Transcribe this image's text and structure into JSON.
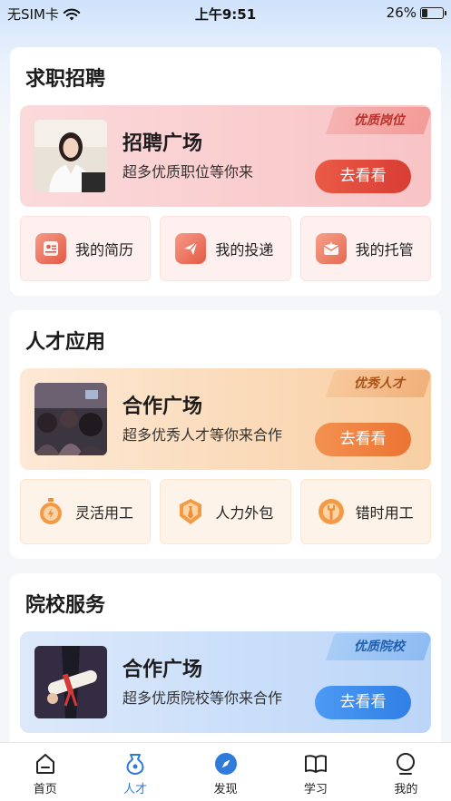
{
  "status": {
    "carrier": "无SIM卡",
    "time": "上午9:51",
    "battery": "26%",
    "battery_level": 0.26
  },
  "sections": [
    {
      "title": "求职招聘",
      "banner": {
        "tag": "优质岗位",
        "title": "招聘广场",
        "subtitle": "超多优质职位等你来",
        "button": "去看看"
      },
      "tiles": [
        {
          "label": "我的简历",
          "icon": "resume-icon"
        },
        {
          "label": "我的投递",
          "icon": "send-icon"
        },
        {
          "label": "我的托管",
          "icon": "envelope-star-icon"
        }
      ]
    },
    {
      "title": "人才应用",
      "banner": {
        "tag": "优秀人才",
        "title": "合作广场",
        "subtitle": "超多优秀人才等你来合作",
        "button": "去看看"
      },
      "tiles": [
        {
          "label": "灵活用工",
          "icon": "stopwatch-icon"
        },
        {
          "label": "人力外包",
          "icon": "tie-icon"
        },
        {
          "label": "错时用工",
          "icon": "wrench-icon"
        }
      ]
    },
    {
      "title": "院校服务",
      "banner": {
        "tag": "优质院校",
        "title": "合作广场",
        "subtitle": "超多优质院校等你来合作",
        "button": "去看看"
      }
    }
  ],
  "tabbar": [
    {
      "label": "首页",
      "icon": "home-icon"
    },
    {
      "label": "人才",
      "icon": "talent-icon",
      "active": true
    },
    {
      "label": "发现",
      "icon": "compass-icon"
    },
    {
      "label": "学习",
      "icon": "book-icon"
    },
    {
      "label": "我的",
      "icon": "profile-icon"
    }
  ],
  "colors": {
    "red_accent": "#e0493e",
    "orange_accent": "#ef7d3c",
    "blue_accent": "#3d8ef0",
    "active_tab": "#2f7bd9"
  }
}
